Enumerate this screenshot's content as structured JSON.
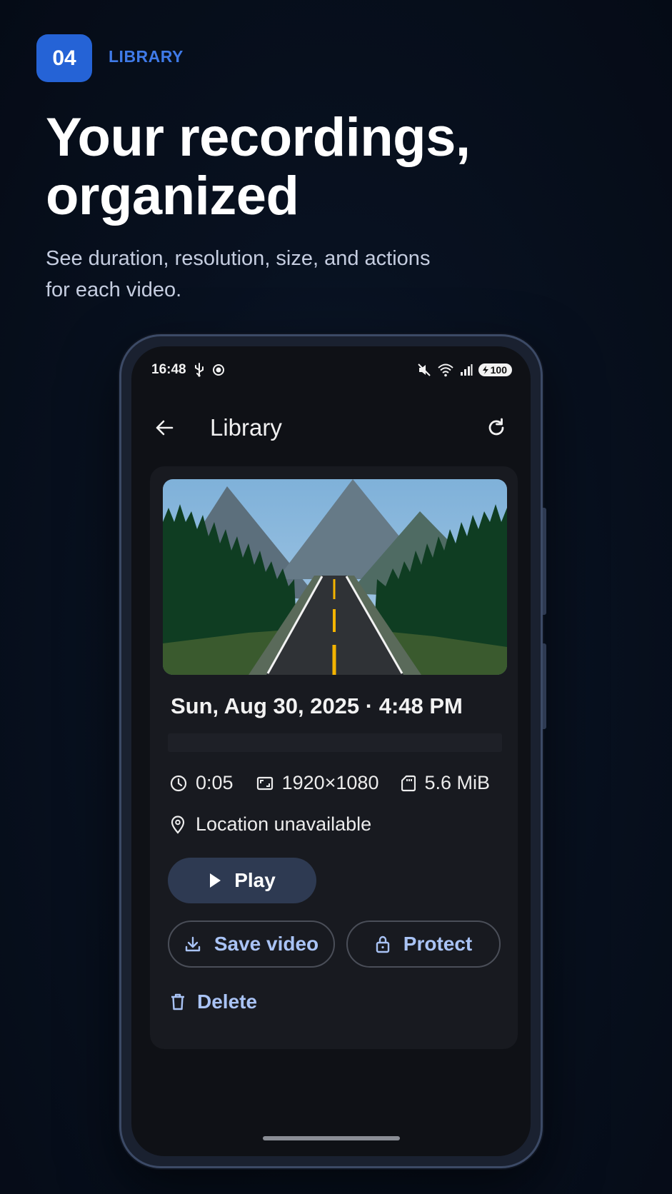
{
  "intro": {
    "step_number": "04",
    "step_label": "LIBRARY",
    "headline_line1": "Your recordings,",
    "headline_line2": "organized",
    "subtext_line1": "See duration, resolution, size, and actions",
    "subtext_line2": "for each video."
  },
  "status_bar": {
    "time": "16:48",
    "left_icons": [
      "usb-icon",
      "record-icon"
    ],
    "right_icons": [
      "mute-icon",
      "wifi-icon",
      "signal-icon"
    ],
    "battery": "100"
  },
  "app_bar": {
    "title": "Library",
    "back_icon": "arrow-left-icon",
    "refresh_icon": "refresh-icon"
  },
  "recording": {
    "date": "Sun, Aug 30, 2025 · 4:48 PM",
    "duration": "0:05",
    "resolution": "1920×1080",
    "size": "5.6 MiB",
    "location": "Location unavailable"
  },
  "actions": {
    "play_label": "Play",
    "save_label": "Save video",
    "protect_label": "Protect",
    "delete_label": "Delete"
  },
  "colors": {
    "accent": "#2563d6",
    "accent_text": "#3f7ae8",
    "action_text": "#a9c3f5",
    "play_bg": "#2e3a52",
    "card_bg": "#181a20",
    "screen_bg": "#0f1116"
  }
}
